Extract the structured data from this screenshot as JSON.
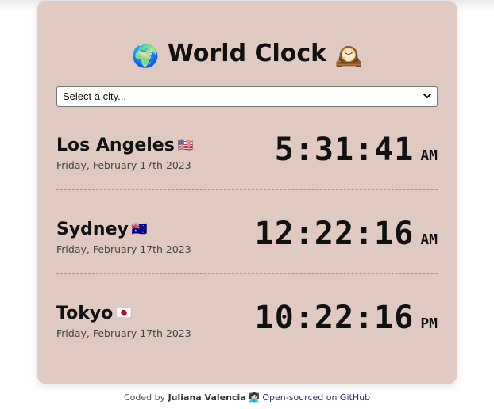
{
  "title": {
    "text": "World Clock",
    "globe_icon": "🌍",
    "clock_icon": "🕰️"
  },
  "city_select": {
    "selected": "Select a city..."
  },
  "cities": [
    {
      "name": "Los Angeles",
      "flag": "🇺🇸",
      "date": "Friday, February 17th 2023",
      "time": "5:31:41",
      "ampm": "AM"
    },
    {
      "name": "Sydney",
      "flag": "🇦🇺",
      "date": "Friday, February 17th 2023",
      "time": "12:22:16",
      "ampm": "AM"
    },
    {
      "name": "Tokyo",
      "flag": "🇯🇵",
      "date": "Friday, February 17th 2023",
      "time": "10:22:16",
      "ampm": "PM"
    }
  ],
  "footer": {
    "coded_by": "Coded by",
    "author": "Juliana Valencia",
    "author_icon": "👩🏻‍💻",
    "link_text": "Open-sourced on GitHub"
  },
  "colors": {
    "card_bg": "#dfc9c1",
    "link": "#3a2b7a"
  }
}
